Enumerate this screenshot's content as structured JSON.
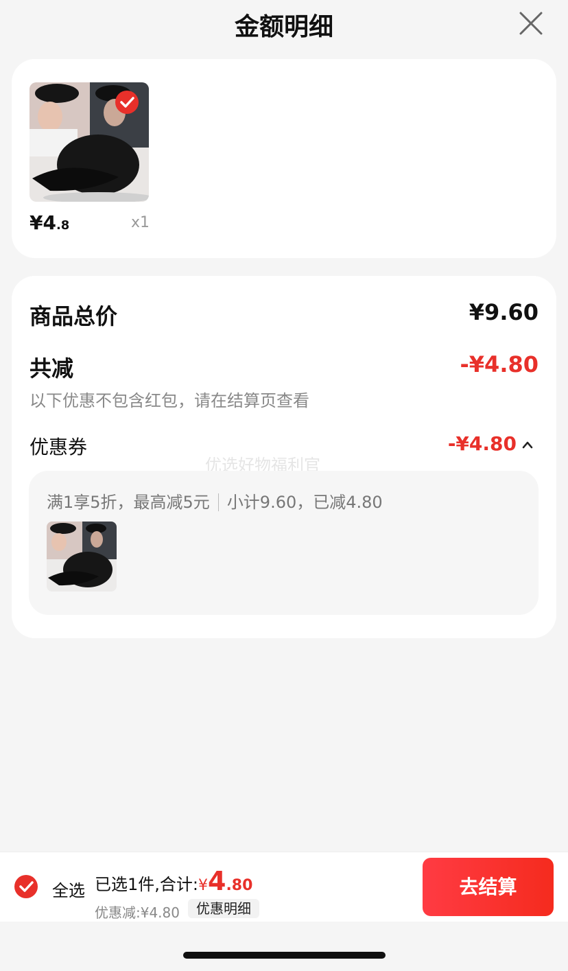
{
  "header": {
    "title": "金额明细"
  },
  "product": {
    "price_main": "¥4",
    "price_decimal": ".8",
    "quantity": "x1",
    "selected": true
  },
  "summary": {
    "total_label": "商品总价",
    "total_value": "¥9.60",
    "discount_label": "共减",
    "discount_value": "-¥4.80",
    "note": "以下优惠不包含红包，请在结算页查看",
    "coupon_label": "优惠券",
    "coupon_value": "-¥4.80",
    "watermark": "优选好物福利官"
  },
  "coupon_detail": {
    "rule": "满1享5折，最高减5元",
    "subtotal": "小计9.60，已减4.80"
  },
  "bottom_bar": {
    "select_all": "全选",
    "selected_text": "已选1件,合计:",
    "currency": "¥",
    "total_main": "4",
    "total_decimal": ".80",
    "discount_text": "优惠减:¥4.80",
    "detail_button": "优惠明细",
    "checkout_button": "去结算"
  },
  "colors": {
    "accent": "#e8302a",
    "checkout_start": "#ff3b43",
    "checkout_end": "#f52b1e",
    "background": "#f5f5f5"
  },
  "icons": {
    "close": "close-icon",
    "check": "checkmark-circle-icon",
    "chevron": "chevron-up-icon"
  }
}
